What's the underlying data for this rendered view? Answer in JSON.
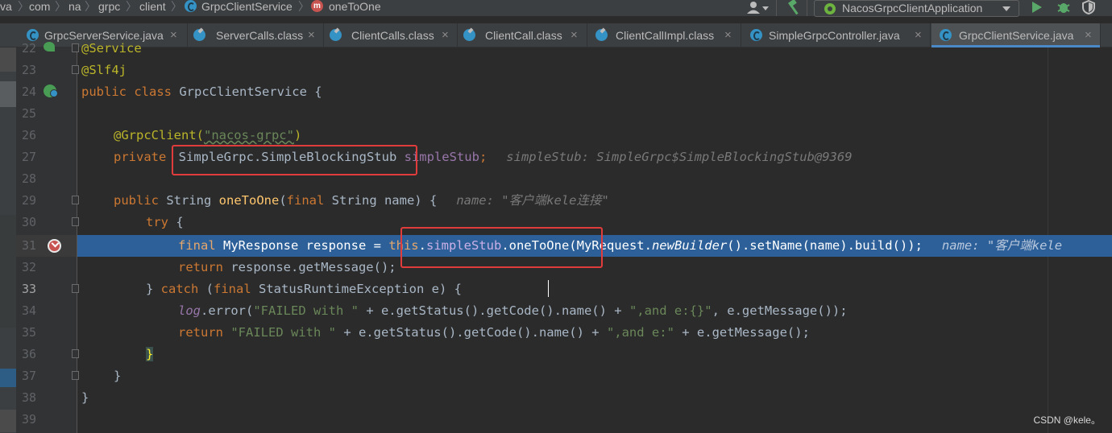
{
  "breadcrumb": {
    "items": [
      "va",
      "com",
      "na",
      "grpc",
      "client",
      "GrpcClientService",
      "oneToOne"
    ]
  },
  "toolbar": {
    "run_config": "NacosGrpcClientApplication",
    "icons": [
      "user-icon",
      "hammer-icon",
      "run-icon",
      "debug-icon",
      "shield-icon"
    ]
  },
  "tabs": [
    {
      "label": "GrpcServerService.java",
      "active": false
    },
    {
      "label": "ServerCalls.class",
      "active": false
    },
    {
      "label": "ClientCalls.class",
      "active": false
    },
    {
      "label": "ClientCall.class",
      "active": false
    },
    {
      "label": "ClientCallImpl.class",
      "active": false
    },
    {
      "label": "SimpleGrpcController.java",
      "active": false
    },
    {
      "label": "GrpcClientService.java",
      "active": true
    }
  ],
  "tab_close_glyph": "×",
  "editor": {
    "line_numbers": [
      "22",
      "23",
      "24",
      "25",
      "26",
      "27",
      "28",
      "29",
      "30",
      "31",
      "32",
      "33",
      "34",
      "35",
      "36",
      "37",
      "38",
      "39"
    ],
    "current_line": "33",
    "breakpoint_line": "31",
    "lines": {
      "l22": {
        "ann": "@Service"
      },
      "l23": {
        "ann": "@Slf4j"
      },
      "l24": {
        "kw": "public class ",
        "name": "GrpcClientService {"
      },
      "l26": {
        "ann": "@GrpcClient(",
        "str": "\"nacos-grpc\"",
        "ann_end": ")"
      },
      "l27": {
        "kw": "private ",
        "type": "SimpleGrpc.SimpleBlockingStub",
        "field": " simpleStub",
        "kw2": ";",
        "hint": "simpleStub: SimpleGrpc$SimpleBlockingStub@9369"
      },
      "l29": {
        "kw": "public ",
        "type": "String ",
        "fn": "oneToOne",
        "p1": "(",
        "kw2": "final ",
        "rest": "String name) {",
        "hint": "name: \"客户端kele连接\""
      },
      "l30": {
        "kw": "try",
        "rest": " {"
      },
      "l31": {
        "kw": "final ",
        "t1": "MyResponse response = ",
        "this": "this",
        "dot": ".",
        "field": "simpleStub",
        "call": ".oneToOne(MyRequest.",
        "static": "newBuilder",
        "rest": "().setName(name).build());",
        "hint": "name: \"客户端kele"
      },
      "l32": {
        "kw": "return ",
        "rest": "response.getMessage();"
      },
      "l33": {
        "p1": "} ",
        "kw": "catch ",
        "p2": "(",
        "kw2": "final ",
        "rest": "StatusRuntimeException e) {"
      },
      "l34": {
        "log": "log",
        "t1": ".error(",
        "str1": "\"FAILED with \"",
        "t2": " + e.getStatus().getCode().name() + ",
        "str2": "\",and e:{}\"",
        "t3": ", e.getMessage());"
      },
      "l35": {
        "kw": "return ",
        "str1": "\"FAILED with \"",
        "t2": " + e.getStatus().getCode().name() + ",
        "str2": "\",and e:\"",
        "t3": " + e.getMessage();"
      },
      "l36": {
        "t1": "}"
      },
      "l37": {
        "t1": "}"
      },
      "l38": {
        "t1": "}"
      }
    }
  },
  "watermark": "CSDN @kele。",
  "colors": {
    "background": "#2b2b2b",
    "keyword": "#cc7832",
    "string": "#6a8759",
    "annotation": "#bbb529",
    "method": "#ffc66d",
    "field": "#9876aa",
    "highlight": "#2d6099",
    "annotation_box": "#e03c3c"
  }
}
